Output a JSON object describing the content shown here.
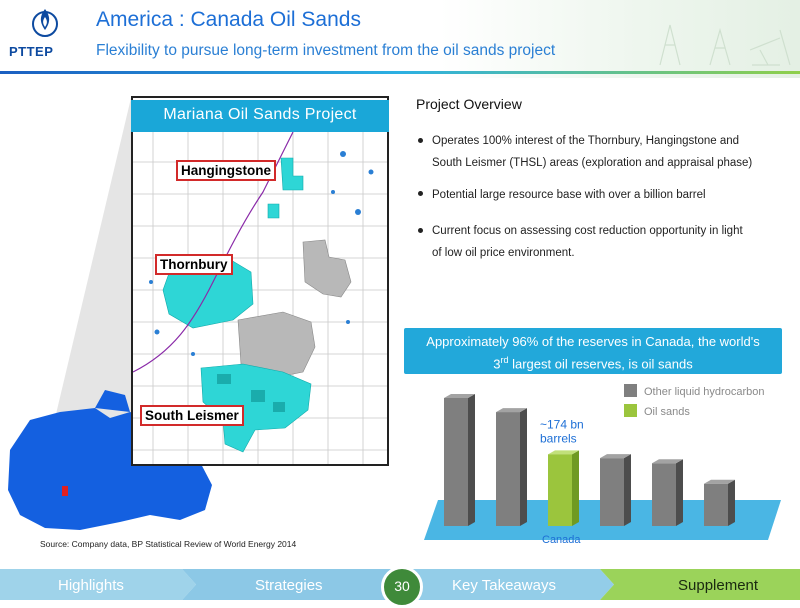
{
  "header": {
    "logo_text": "PTTEP",
    "title": "America : Canada Oil Sands",
    "subtitle": "Flexibility to pursue long-term investment from  the oil sands project"
  },
  "map": {
    "title": "Mariana Oil Sands Project",
    "labels": {
      "hangingstone": "Hangingstone",
      "thornbury": "Thornbury",
      "south_leismer": "South Leismer"
    }
  },
  "overview": {
    "title": "Project Overview",
    "bullets": [
      "Operates 100% interest of the Thornbury, Hangingstone and",
      "South Leismer (THSL) areas (exploration and appraisal phase)",
      "Potential large resource base with over a billion barrel",
      "Current focus on assessing cost reduction opportunity in light",
      "of low oil price environment."
    ]
  },
  "callout": {
    "line1": "Approximately 96% of the reserves in Canada, the world's",
    "line2_prefix": "3",
    "line2_sup": "rd",
    "line2_suffix": " largest oil reserves, is oil sands"
  },
  "colors": {
    "other_liquid": "#7f7f7f",
    "oil_sands": "#9bc53d",
    "callout_bg": "#22a8da",
    "map_teal": "#2ed6d6",
    "title_blue": "#1d6fd6"
  },
  "chart_data": {
    "type": "bar",
    "categories": [
      "",
      "",
      "Canada",
      "",
      "",
      ""
    ],
    "series": [
      {
        "name": "Other liquid hydrocarbon",
        "values": [
          1.0,
          0.89,
          0,
          0.53,
          0.49,
          0.33
        ]
      },
      {
        "name": "Oil sands",
        "values": [
          0,
          0,
          0.56,
          0,
          0,
          0
        ]
      }
    ],
    "legend": [
      "Other liquid hydrocarbon",
      "Oil sands"
    ],
    "legend_position": "top-right",
    "annotation": "~174 bn barrels",
    "annotation_lines": [
      "~174 bn",
      "barrels"
    ],
    "highlight_category": "Canada",
    "grid": false
  },
  "source": "Source: Company data, BP Statistical Review of World Energy 2014",
  "footer": {
    "tabs": [
      "Highlights",
      "Strategies",
      "Key Takeaways",
      "Supplement"
    ],
    "page_number": "30"
  }
}
